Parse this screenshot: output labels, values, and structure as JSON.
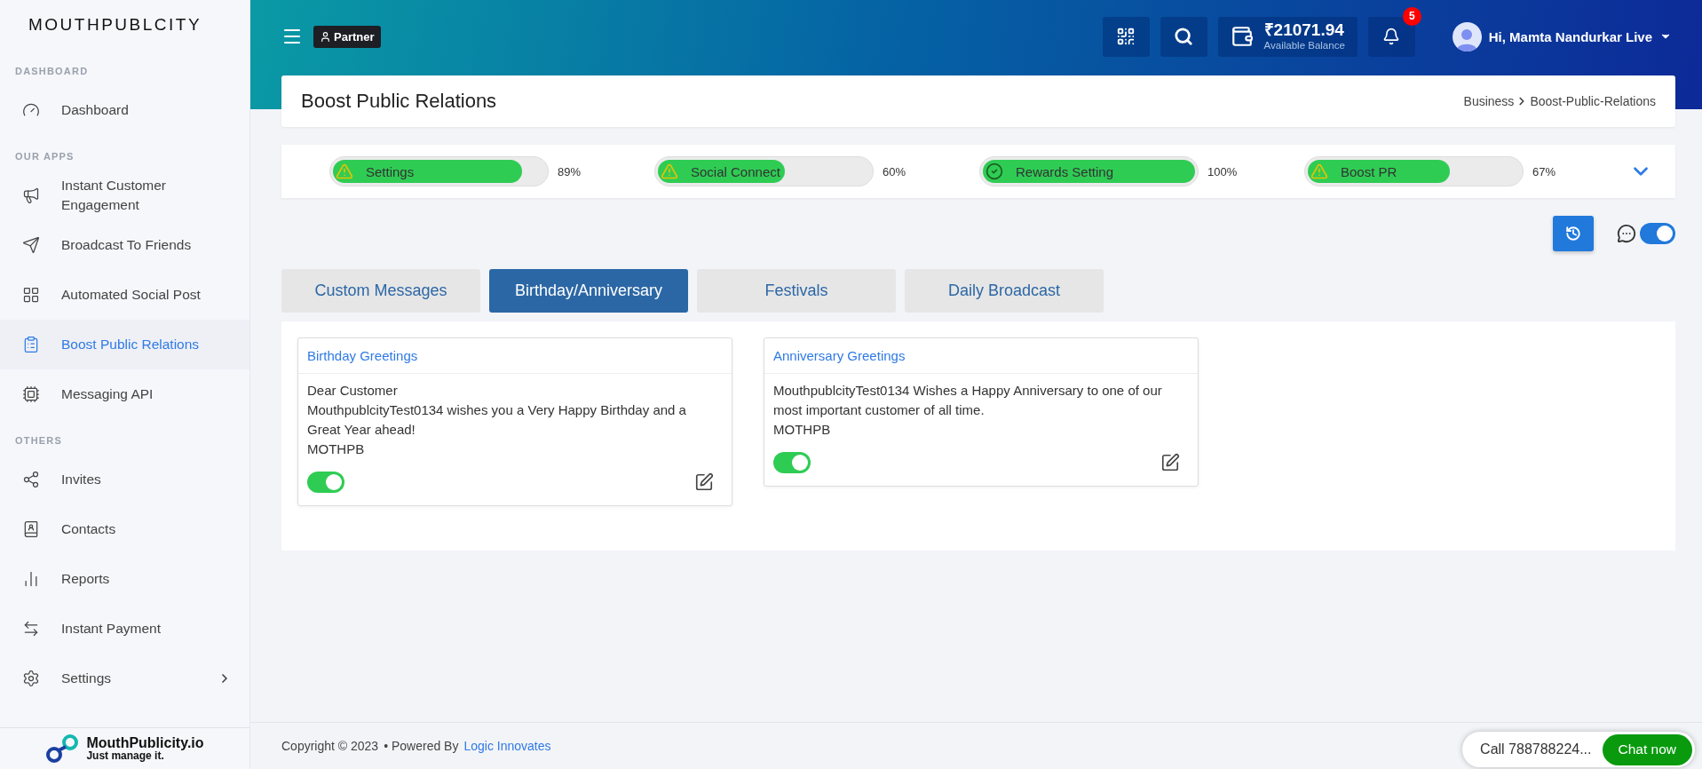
{
  "sidebar": {
    "brand": "MOUTHPUBLCITY",
    "sections": [
      {
        "heading": "DASHBOARD",
        "items": [
          {
            "label": "Dashboard",
            "selected": false,
            "submenu": false
          }
        ]
      },
      {
        "heading": "OUR APPS",
        "items": [
          {
            "label": "Instant Customer Engagement",
            "selected": false,
            "submenu": false
          },
          {
            "label": "Broadcast To Friends",
            "selected": false,
            "submenu": false
          },
          {
            "label": "Automated Social Post",
            "selected": false,
            "submenu": false
          },
          {
            "label": "Boost Public Relations",
            "selected": true,
            "submenu": false
          },
          {
            "label": "Messaging API",
            "selected": false,
            "submenu": false
          }
        ]
      },
      {
        "heading": "OTHERS",
        "items": [
          {
            "label": "Invites",
            "selected": false,
            "submenu": false
          },
          {
            "label": "Contacts",
            "selected": false,
            "submenu": false
          },
          {
            "label": "Reports",
            "selected": false,
            "submenu": false
          },
          {
            "label": "Instant Payment",
            "selected": false,
            "submenu": false
          },
          {
            "label": "Settings",
            "selected": false,
            "submenu": true
          }
        ]
      }
    ],
    "footer_logo": {
      "name": "MouthPublicity.io",
      "tagline": "Just manage it."
    }
  },
  "topbar": {
    "partner_badge": "Partner",
    "balance": {
      "amount": "₹21071.94",
      "caption": "Available Balance"
    },
    "notifications": "5",
    "user": "Hi, Mamta Nandurkar Live"
  },
  "page": {
    "title": "Boost Public Relations",
    "breadcrumb": [
      "Business",
      "Boost-Public-Relations"
    ]
  },
  "progress": [
    {
      "label": "Settings",
      "kind": "warning",
      "level": 0.89,
      "reading": "89%"
    },
    {
      "label": "Social Connect",
      "kind": "warning",
      "level": 0.6,
      "reading": "60%"
    },
    {
      "label": "Rewards Setting",
      "kind": "done",
      "level": 1,
      "reading": "100%"
    },
    {
      "label": "Boost PR",
      "kind": "warning",
      "level": 0.67,
      "reading": "67%"
    }
  ],
  "chat_toggle": {
    "on": true
  },
  "tabs": [
    {
      "label": "Custom Messages",
      "selected": false
    },
    {
      "label": "Birthday/Anniversary",
      "selected": true
    },
    {
      "label": "Festivals",
      "selected": false
    },
    {
      "label": "Daily Broadcast",
      "selected": false
    }
  ],
  "cards": [
    {
      "title": "Birthday Greetings",
      "lines": [
        "Dear Customer",
        "MouthpublcityTest0134 wishes you a Very Happy Birthday and a Great Year ahead!",
        "MOTHPB"
      ],
      "on": true
    },
    {
      "title": "Anniversary Greetings",
      "lines": [
        "MouthpublcityTest0134 Wishes a Happy Anniversary to one of our most important customer of all time.",
        "MOTHPB"
      ],
      "on": true
    }
  ],
  "footer": {
    "copyright": "Copyright © 2023",
    "powered_by": "• Powered By",
    "link": "Logic Innovates"
  },
  "chat_widget": {
    "call": "Call 788788224...",
    "button": "Chat now"
  }
}
